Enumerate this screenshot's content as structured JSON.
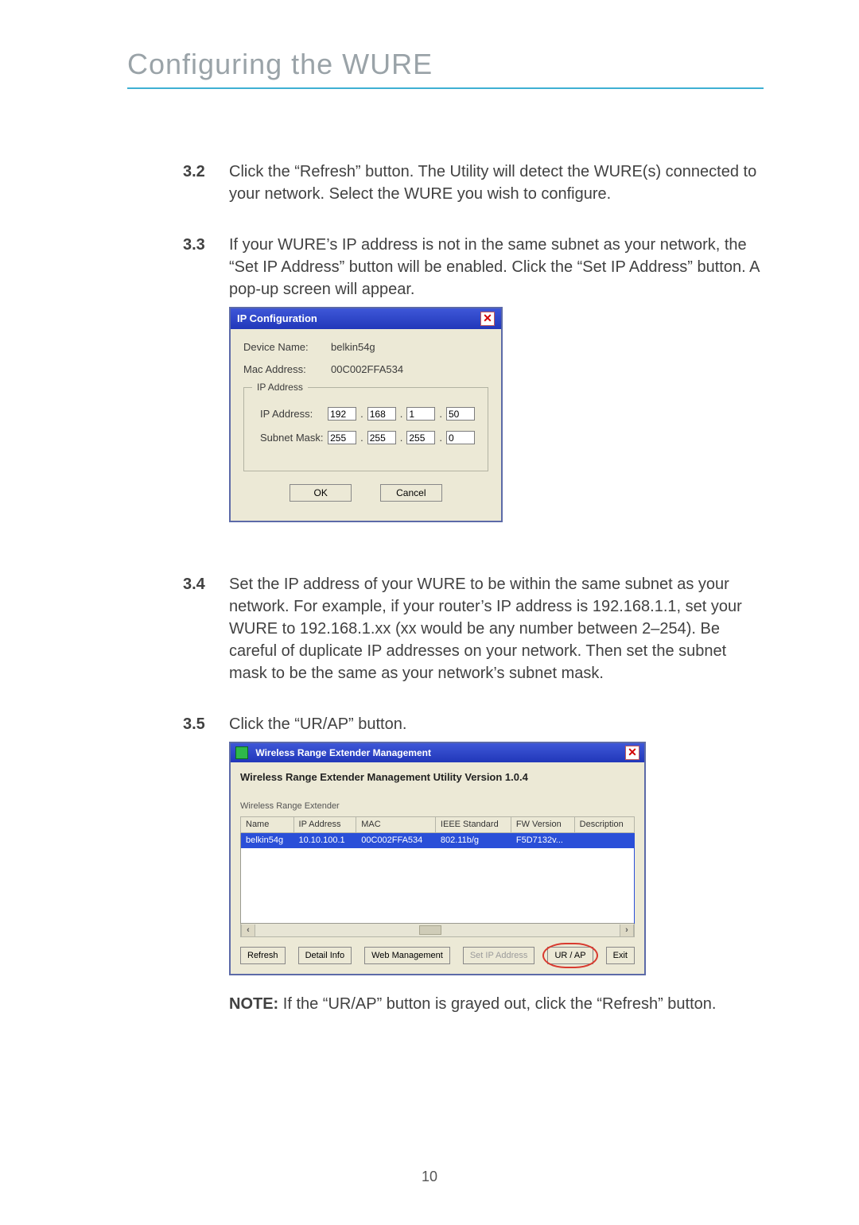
{
  "title": "Configuring the WURE",
  "steps": [
    {
      "num": "3.2",
      "text": "Click the “Refresh” button. The Utility will detect the WURE(s) connected to your network. Select the WURE you wish to configure."
    },
    {
      "num": "3.3",
      "text": "If your WURE’s IP address is not in the same subnet as your network, the “Set IP Address” button will be enabled. Click the “Set IP Address” button. A pop-up screen will appear."
    },
    {
      "num": "3.4",
      "text": "Set the IP address of your WURE to be within the same subnet as your network. For example, if your router’s IP address is 192.168.1.1, set your WURE to 192.168.1.xx  (xx would be any number between 2–254). Be careful of duplicate IP addresses on your network. Then set the subnet mask to be the same as your network’s subnet mask."
    },
    {
      "num": "3.5",
      "text": "Click the “UR/AP” button."
    }
  ],
  "note": {
    "label": "NOTE:",
    "text": " If the “UR/AP” button is grayed out, click the “Refresh” button."
  },
  "page_number": "10",
  "ipcfg": {
    "title": "IP Configuration",
    "device_name_label": "Device Name:",
    "device_name": "belkin54g",
    "mac_label": "Mac Address:",
    "mac": "00C002FFA534",
    "group_legend": "IP Address",
    "ip_label": "IP Address:",
    "ip_octets": [
      "192",
      "168",
      "1",
      "50"
    ],
    "subnet_label": "Subnet Mask:",
    "subnet_octets": [
      "255",
      "255",
      "255",
      "0"
    ],
    "ok": "OK",
    "cancel": "Cancel"
  },
  "mgmt": {
    "title": "Wireless Range Extender Management",
    "heading": "Wireless Range Extender Management Utility Version 1.0.4",
    "section": "Wireless Range Extender",
    "headers": [
      "Name",
      "IP Address",
      "MAC",
      "IEEE Standard",
      "FW Version",
      "Description"
    ],
    "row": [
      "belkin54g",
      "10.10.100.1",
      "00C002FFA534",
      "802.11b/g",
      "F5D7132v...",
      ""
    ],
    "buttons": {
      "refresh": "Refresh",
      "detail": "Detail Info",
      "web": "Web Management",
      "setip": "Set IP Address",
      "urap": "UR / AP",
      "exit": "Exit"
    }
  }
}
